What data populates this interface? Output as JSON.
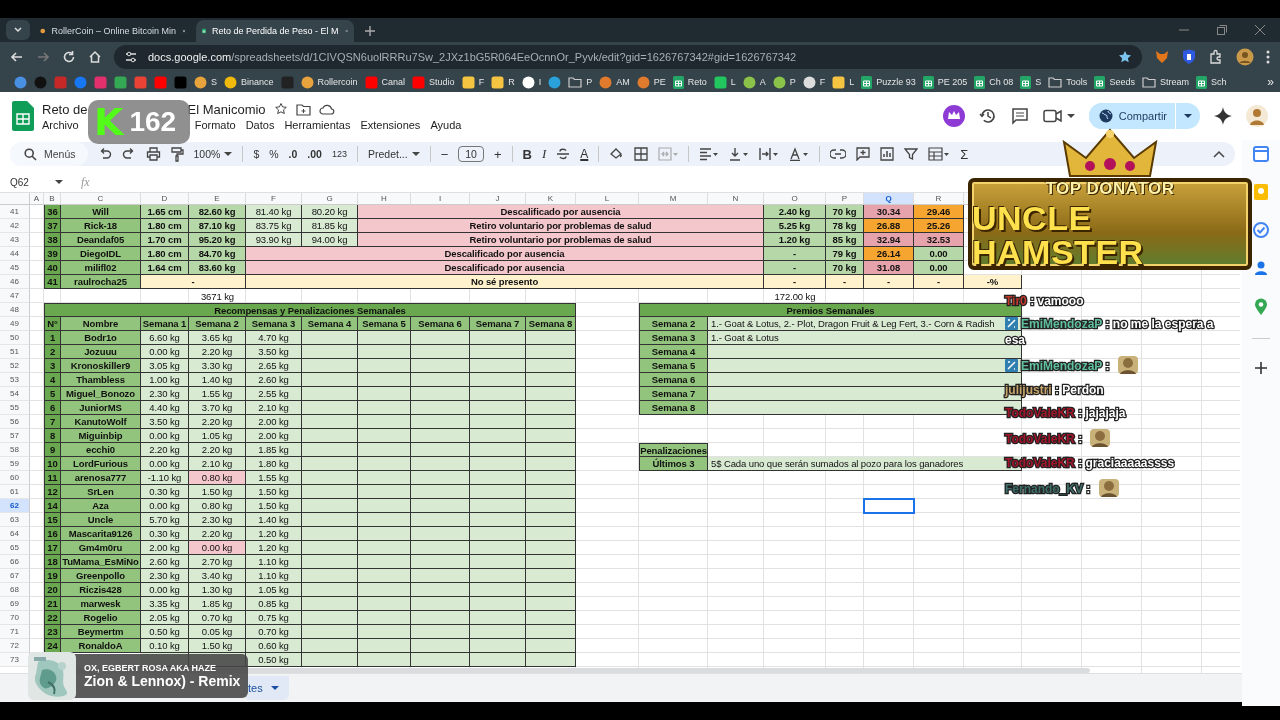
{
  "browser": {
    "tabs": [
      {
        "title": "RollerCoin – Online Bitcoin Min",
        "selected": false
      },
      {
        "title": "Reto de Perdida de Peso - El M",
        "selected": true
      }
    ],
    "url_host": "docs.google.com",
    "url_path": "/spreadsheets/d/1CIVQSN6uolRRRu7Sw_2JXz1bG5R064EeOcnnOr_Pyvk/edit?gid=1626767342#gid=1626767342",
    "bookmarks": [
      {
        "kind": "round",
        "color": "#4a90e2"
      },
      {
        "kind": "round",
        "color": "#111111"
      },
      {
        "kind": "square",
        "color": "#c62828"
      },
      {
        "kind": "round",
        "color": "#1877f2"
      },
      {
        "kind": "square",
        "color": "#e1306c"
      },
      {
        "kind": "square",
        "color": "#34a853"
      },
      {
        "kind": "square",
        "color": "#ea4335"
      },
      {
        "kind": "square",
        "color": "#ff0000"
      },
      {
        "kind": "square",
        "color": "#000000"
      },
      {
        "kind": "round",
        "color": "#e8a33c",
        "label": "S"
      },
      {
        "kind": "round",
        "color": "#f0b90b",
        "label": "Binance"
      },
      {
        "kind": "square",
        "color": "#222222"
      },
      {
        "kind": "round",
        "color": "#e8a33c",
        "label": "Rollercoin"
      },
      {
        "kind": "square",
        "color": "#ff0000",
        "label": "Canal"
      },
      {
        "kind": "square",
        "color": "#ff0000",
        "label": "Studio"
      },
      {
        "kind": "square",
        "color": "#f5c542",
        "label": "F"
      },
      {
        "kind": "square",
        "color": "#f5c542",
        "label": "R"
      },
      {
        "kind": "round",
        "color": "#ffffff",
        "label": "I"
      },
      {
        "kind": "round",
        "color": "#2aa1da"
      },
      {
        "kind": "folder",
        "label": "P"
      },
      {
        "kind": "round",
        "color": "#e07a2c",
        "label": "AM"
      },
      {
        "kind": "round",
        "color": "#e07a2c",
        "label": "PE"
      },
      {
        "kind": "sheet",
        "label": "Reto"
      },
      {
        "kind": "square",
        "color": "#22c55e",
        "label": "L"
      },
      {
        "kind": "round",
        "color": "#8bc34a",
        "label": "A"
      },
      {
        "kind": "round",
        "color": "#8bc34a",
        "label": "P"
      },
      {
        "kind": "round",
        "color": "#dddddd",
        "label": "F"
      },
      {
        "kind": "square",
        "color": "#f5c542",
        "label": "L"
      },
      {
        "kind": "sheet",
        "label": "Puzzle 93"
      },
      {
        "kind": "sheet",
        "label": "PE 205"
      },
      {
        "kind": "sheet",
        "label": "Ch 08"
      },
      {
        "kind": "sheet",
        "label": "S"
      },
      {
        "kind": "folder",
        "label": "Tools"
      },
      {
        "kind": "sheet",
        "label": "Seeds"
      },
      {
        "kind": "folder",
        "label": "Stream"
      },
      {
        "kind": "sheet",
        "label": "Sch"
      }
    ],
    "more": "»"
  },
  "document": {
    "title_start": "Reto de",
    "title_end": "El Manicomio",
    "menu_start": [
      "Archivo"
    ],
    "menu_end": [
      "Formato",
      "Datos",
      "Herramientas",
      "Extensiones",
      "Ayuda"
    ],
    "share": "Compartir"
  },
  "stream_badge": {
    "logo": "K",
    "count": "162"
  },
  "toolbar": {
    "search": "Menús",
    "zoom": "100%",
    "currency": "$",
    "percent": "%",
    "decrease_decimals": ".0",
    "increase_decimals": ".00",
    "number_format": "123",
    "font": "Predet...",
    "minus": "−",
    "font_size": "10",
    "plus": "+",
    "bold": "B",
    "italic": "I",
    "text_color": "A",
    "sum": "Σ"
  },
  "formula_bar": {
    "cell": "Q62",
    "fx": "fx"
  },
  "sheet": {
    "column_headers": [
      {
        "label": "A",
        "selected": false
      },
      {
        "label": "B",
        "selected": false
      },
      {
        "label": "C",
        "selected": false
      },
      {
        "label": "D",
        "selected": false
      },
      {
        "label": "E",
        "selected": false
      },
      {
        "label": "F",
        "selected": false
      },
      {
        "label": "G",
        "selected": false
      },
      {
        "label": "H",
        "selected": false
      },
      {
        "label": "I",
        "selected": false
      },
      {
        "label": "J",
        "selected": false
      },
      {
        "label": "K",
        "selected": false
      },
      {
        "label": "L",
        "selected": false
      },
      {
        "label": "M",
        "selected": false
      },
      {
        "label": "N",
        "selected": false
      },
      {
        "label": "O",
        "selected": false
      },
      {
        "label": "P",
        "selected": false
      },
      {
        "label": "Q",
        "selected": true
      },
      {
        "label": "R",
        "selected": false
      }
    ],
    "row_headers": [
      {
        "label": "41",
        "selected": false
      },
      {
        "label": "42",
        "selected": false
      },
      {
        "label": "43",
        "selected": false
      },
      {
        "label": "44",
        "selected": false
      },
      {
        "label": "45",
        "selected": false
      },
      {
        "label": "46",
        "selected": false
      },
      {
        "label": "47",
        "selected": false
      },
      {
        "label": "48",
        "selected": false
      },
      {
        "label": "49",
        "selected": false
      },
      {
        "label": "50",
        "selected": false
      },
      {
        "label": "51",
        "selected": false
      },
      {
        "label": "52",
        "selected": false
      },
      {
        "label": "53",
        "selected": false
      },
      {
        "label": "54",
        "selected": false
      },
      {
        "label": "55",
        "selected": false
      },
      {
        "label": "56",
        "selected": false
      },
      {
        "label": "57",
        "selected": false
      },
      {
        "label": "58",
        "selected": false
      },
      {
        "label": "59",
        "selected": false
      },
      {
        "label": "60",
        "selected": false
      },
      {
        "label": "61",
        "selected": false
      },
      {
        "label": "62",
        "selected": true
      },
      {
        "label": "63",
        "selected": false
      },
      {
        "label": "64",
        "selected": false
      },
      {
        "label": "65",
        "selected": false
      },
      {
        "label": "66",
        "selected": false
      },
      {
        "label": "67",
        "selected": false
      },
      {
        "label": "68",
        "selected": false
      },
      {
        "label": "69",
        "selected": false
      },
      {
        "label": "70",
        "selected": false
      },
      {
        "label": "71",
        "selected": false
      },
      {
        "label": "72",
        "selected": false
      },
      {
        "label": "73",
        "selected": false
      }
    ],
    "participants": [
      {
        "kind": "retired",
        "n": "36",
        "name": "Will",
        "height": "1.65 cm",
        "start": "82.60 kg",
        "week_1": "81.40 kg",
        "week_2": "80.20 kg",
        "note": "Descalificado por ausencia",
        "loss": "2.40 kg",
        "target": "70 kg",
        "q": {
          "text": "30.34",
          "color": "#e6a3ab"
        },
        "r": {
          "text": "29.46",
          "color": "#f6a530"
        }
      },
      {
        "kind": "retired",
        "n": "37",
        "name": "Rick-18",
        "height": "1.80 cm",
        "start": "87.10 kg",
        "week_1": "83.75 kg",
        "week_2": "81.85 kg",
        "note": "Retiro voluntario por problemas de salud",
        "loss": "5.25 kg",
        "target": "78 kg",
        "q": {
          "text": "26.88",
          "color": "#f6a530"
        },
        "r": {
          "text": "25.26",
          "color": "#f6a530"
        }
      },
      {
        "kind": "retired",
        "n": "38",
        "name": "Deandaf05",
        "height": "1.70 cm",
        "start": "95.20 kg",
        "week_1": "93.90 kg",
        "week_2": "94.00 kg",
        "note": "Retiro voluntario por problemas de salud",
        "loss": "1.20 kg",
        "target": "85 kg",
        "q": {
          "text": "32.94",
          "color": "#e6a3ab"
        },
        "r": {
          "text": "32.53",
          "color": "#e6a3ab"
        }
      },
      {
        "kind": "disqualified",
        "n": "39",
        "name": "DiegoIDL",
        "height": "1.80 cm",
        "start": "84.70 kg",
        "note": "Descalificado por ausencia",
        "loss": "-",
        "target": "79 kg",
        "q": {
          "text": "26.14",
          "color": "#f6a530"
        },
        "r": {
          "text": "0.00",
          "color": "#b6d7a8"
        }
      },
      {
        "kind": "disqualified",
        "n": "40",
        "name": "milifl02",
        "height": "1.64 cm",
        "start": "83.60 kg",
        "note": "Descalificado por ausencia",
        "loss": "-",
        "target": "70 kg",
        "q": {
          "text": "31.08",
          "color": "#e6a3ab"
        },
        "r": {
          "text": "0.00",
          "color": "#b6d7a8"
        }
      },
      {
        "kind": "no_show",
        "n": "41",
        "name": "raulrocha25",
        "height": "-",
        "note": "No sé presento",
        "loss": "-",
        "target": "-",
        "q": {
          "text": "-",
          "color": "#fff2cc"
        },
        "r": {
          "text": "-",
          "color": "#fff2cc"
        },
        "s": "-%"
      }
    ],
    "totals": {
      "weight": "3671 kg",
      "loss": "172.00 kg"
    }
  },
  "rewards": {
    "title": "Recompensas y Penalizaciones Semanales",
    "headers": [
      "N°",
      "Nombre",
      "Semana 1",
      "Semana 2",
      "Semana 3",
      "Semana 4",
      "Semana 5",
      "Semana 6",
      "Semana 7",
      "Semana 8"
    ],
    "rows": [
      {
        "n": "1",
        "name": "Bodr1o",
        "weeks": [
          {
            "value": "6.60 kg",
            "penalized": false
          },
          {
            "value": "3.65 kg",
            "penalized": false
          },
          {
            "value": "4.70 kg",
            "penalized": false
          }
        ]
      },
      {
        "n": "2",
        "name": "Jozuuu",
        "weeks": [
          {
            "value": "0.00 kg",
            "penalized": false
          },
          {
            "value": "2.20 kg",
            "penalized": false
          },
          {
            "value": "3.50 kg",
            "penalized": false
          }
        ]
      },
      {
        "n": "3",
        "name": "Kronoskiller9",
        "weeks": [
          {
            "value": "3.05 kg",
            "penalized": false
          },
          {
            "value": "3.30 kg",
            "penalized": false
          },
          {
            "value": "2.65 kg",
            "penalized": false
          }
        ]
      },
      {
        "n": "4",
        "name": "Thambless",
        "weeks": [
          {
            "value": "1.00 kg",
            "penalized": false
          },
          {
            "value": "1.40 kg",
            "penalized": false
          },
          {
            "value": "2.60 kg",
            "penalized": false
          }
        ]
      },
      {
        "n": "5",
        "name": "Miguel_Bonozo",
        "weeks": [
          {
            "value": "2.30 kg",
            "penalized": false
          },
          {
            "value": "1.55 kg",
            "penalized": false
          },
          {
            "value": "2.55 kg",
            "penalized": false
          }
        ]
      },
      {
        "n": "6",
        "name": "JuniorMS",
        "weeks": [
          {
            "value": "4.40 kg",
            "penalized": false
          },
          {
            "value": "3.70 kg",
            "penalized": false
          },
          {
            "value": "2.10 kg",
            "penalized": false
          }
        ]
      },
      {
        "n": "7",
        "name": "KanutoWolf",
        "weeks": [
          {
            "value": "3.50 kg",
            "penalized": false
          },
          {
            "value": "2.20 kg",
            "penalized": false
          },
          {
            "value": "2.00 kg",
            "penalized": false
          }
        ]
      },
      {
        "n": "8",
        "name": "Miguinbip",
        "weeks": [
          {
            "value": "0.00 kg",
            "penalized": false
          },
          {
            "value": "1.05 kg",
            "penalized": false
          },
          {
            "value": "2.00 kg",
            "penalized": false
          }
        ]
      },
      {
        "n": "9",
        "name": "ecchi0",
        "weeks": [
          {
            "value": "2.20 kg",
            "penalized": false
          },
          {
            "value": "2.20 kg",
            "penalized": false
          },
          {
            "value": "1.85 kg",
            "penalized": false
          }
        ]
      },
      {
        "n": "10",
        "name": "LordFurious",
        "weeks": [
          {
            "value": "0.00 kg",
            "penalized": false
          },
          {
            "value": "2.10 kg",
            "penalized": false
          },
          {
            "value": "1.80 kg",
            "penalized": false
          }
        ]
      },
      {
        "n": "11",
        "name": "arenosa777",
        "weeks": [
          {
            "value": "-1.10 kg",
            "penalized": false
          },
          {
            "value": "0.80 kg",
            "penalized": true
          },
          {
            "value": "1.55 kg",
            "penalized": false
          }
        ]
      },
      {
        "n": "12",
        "name": "SrLen",
        "weeks": [
          {
            "value": "0.30 kg",
            "penalized": false
          },
          {
            "value": "1.50 kg",
            "penalized": false
          },
          {
            "value": "1.50 kg",
            "penalized": false
          }
        ]
      },
      {
        "n": "14",
        "name": "Aza",
        "weeks": [
          {
            "value": "0.00 kg",
            "penalized": false
          },
          {
            "value": "0.80 kg",
            "penalized": false
          },
          {
            "value": "1.50 kg",
            "penalized": false
          }
        ]
      },
      {
        "n": "15",
        "name": "Uncle",
        "weeks": [
          {
            "value": "5.70 kg",
            "penalized": false
          },
          {
            "value": "2.30 kg",
            "penalized": false
          },
          {
            "value": "1.40 kg",
            "penalized": false
          }
        ]
      },
      {
        "n": "16",
        "name": "Mascarita9126",
        "weeks": [
          {
            "value": "0.30 kg",
            "penalized": false
          },
          {
            "value": "2.20 kg",
            "penalized": false
          },
          {
            "value": "1.20 kg",
            "penalized": false
          }
        ]
      },
      {
        "n": "17",
        "name": "Gm4m0ru",
        "weeks": [
          {
            "value": "2.00 kg",
            "penalized": false
          },
          {
            "value": "0.00 kg",
            "penalized": true
          },
          {
            "value": "1.20 kg",
            "penalized": false
          }
        ]
      },
      {
        "n": "18",
        "name": "TuMama_EsMiNo",
        "weeks": [
          {
            "value": "2.60 kg",
            "penalized": false
          },
          {
            "value": "2.70 kg",
            "penalized": false
          },
          {
            "value": "1.10 kg",
            "penalized": false
          }
        ]
      },
      {
        "n": "19",
        "name": "Greenpollo",
        "weeks": [
          {
            "value": "2.30 kg",
            "penalized": false
          },
          {
            "value": "3.40 kg",
            "penalized": false
          },
          {
            "value": "1.10 kg",
            "penalized": false
          }
        ]
      },
      {
        "n": "20",
        "name": "Riczis428",
        "weeks": [
          {
            "value": "0.00 kg",
            "penalized": false
          },
          {
            "value": "1.30 kg",
            "penalized": false
          },
          {
            "value": "1.05 kg",
            "penalized": false
          }
        ]
      },
      {
        "n": "21",
        "name": "marwesk",
        "weeks": [
          {
            "value": "3.35 kg",
            "penalized": false
          },
          {
            "value": "1.85 kg",
            "penalized": false
          },
          {
            "value": "0.85 kg",
            "penalized": false
          }
        ]
      },
      {
        "n": "22",
        "name": "Rogelio",
        "weeks": [
          {
            "value": "2.05 kg",
            "penalized": false
          },
          {
            "value": "0.70 kg",
            "penalized": false
          },
          {
            "value": "0.75 kg",
            "penalized": false
          }
        ]
      },
      {
        "n": "23",
        "name": "Beymertm",
        "weeks": [
          {
            "value": "0.50 kg",
            "penalized": false
          },
          {
            "value": "0.05 kg",
            "penalized": false
          },
          {
            "value": "0.70 kg",
            "penalized": false
          }
        ]
      },
      {
        "n": "24",
        "name": "RonaldoA",
        "weeks": [
          {
            "value": "0.10 kg",
            "penalized": false
          },
          {
            "value": "1.50 kg",
            "penalized": false
          },
          {
            "value": "0.60 kg",
            "penalized": false
          }
        ]
      },
      {
        "weeks": [
          {
            "penalized": false
          },
          {
            "penalized": false
          },
          {
            "value": "0.50 kg",
            "penalized": false
          }
        ]
      }
    ]
  },
  "prizes": {
    "title": "Premios Semanales",
    "rows": [
      {
        "week": "Semana 2",
        "text": "1.- Goat & Lotus, 2.- Plot, Dragon Fruit & Leg Fert, 3.- Corn & Radish"
      },
      {
        "week": "Semana 3",
        "text": "1.- Goat & Lotus"
      },
      {
        "week": "Semana 4"
      },
      {
        "week": "Semana 5"
      },
      {
        "week": "Semana 6"
      },
      {
        "week": "Semana 7"
      },
      {
        "week": "Semana 8"
      }
    ]
  },
  "penalties": {
    "title": "Penalizaciones",
    "rows": [
      {
        "label": "Últimos 3",
        "text": "5$ Cada uno que serán sumados al pozo para los ganadores"
      }
    ]
  },
  "sheet_tab": {
    "label": "tes",
    "selected": true
  },
  "donator_banner": {
    "top": "TOP DONATOR",
    "name": "UNCLE HAMSTER"
  },
  "chat": [
    {
      "user": "Tir0",
      "color": "#c0392b",
      "text": ": vamooo"
    },
    {
      "user": "EmiMendozaP",
      "color": "#5fbf9f",
      "badge": true,
      "text": ": no me la espera a esa"
    },
    {
      "user": "EmiMendozaP",
      "color": "#5fbf9f",
      "badge": true,
      "text": ":",
      "emote": true
    },
    {
      "user": "julijustri",
      "color": "#c8a46a",
      "text": ": Perdon"
    },
    {
      "user": "TodoValeKR",
      "color": "#a3152a",
      "text": ": jajajaja"
    },
    {
      "user": "TodoValeKR",
      "color": "#a3152a",
      "text": ":",
      "emote": true
    },
    {
      "user": "TodoValeKR",
      "color": "#a3152a",
      "text": ": graciaaaaassss"
    },
    {
      "user": "Fernando_KV",
      "color": "#3f6f6a",
      "text": ":",
      "emote": true
    }
  ],
  "music": {
    "artists": "OX, EGBERT ROSA AKA HAZE",
    "title": "Zion & Lennox) - Remix"
  }
}
